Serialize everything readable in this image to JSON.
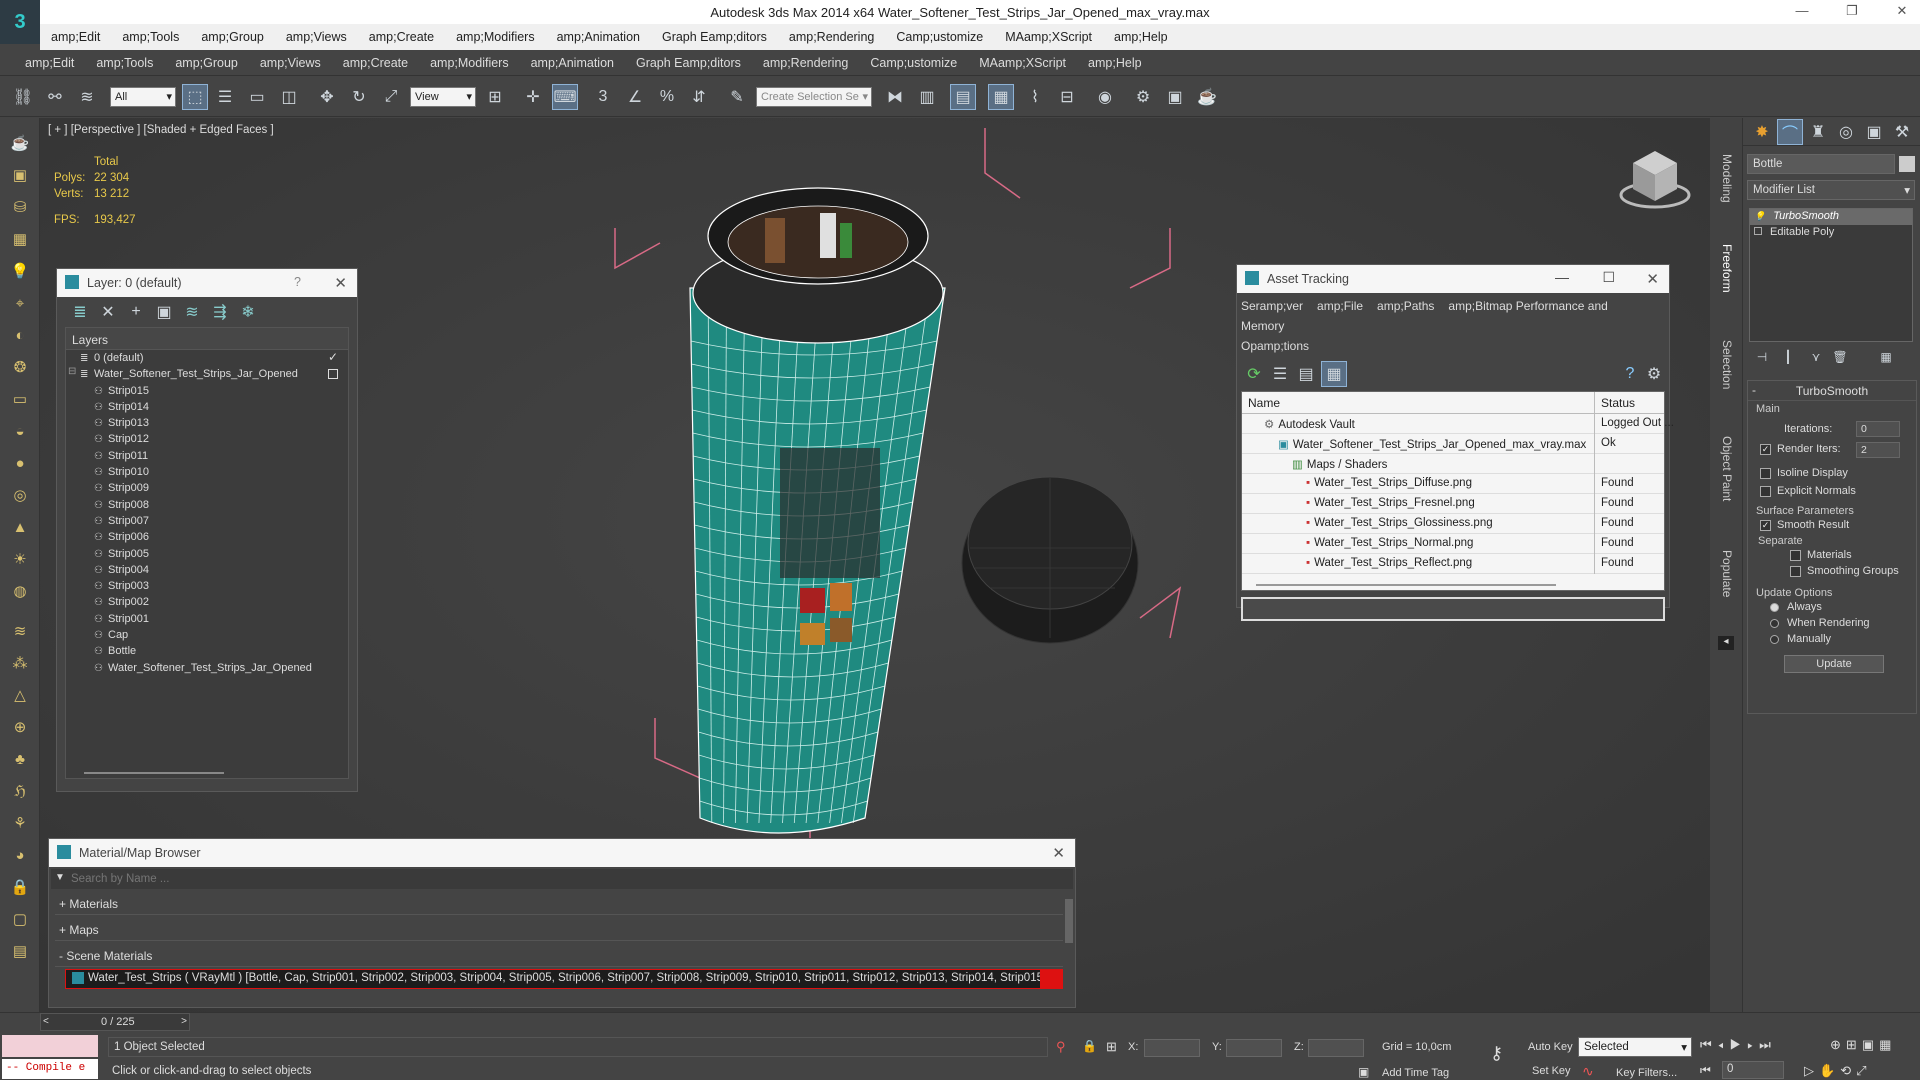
{
  "window": {
    "title": "Autodesk 3ds Max  2014 x64    Water_Softener_Test_Strips_Jar_Opened_max_vray.max"
  },
  "menu1": [
    "amp;Edit",
    "amp;Tools",
    "amp;Group",
    "amp;Views",
    "amp;Create",
    "amp;Modifiers",
    "amp;Animation",
    "Graph Eamp;ditors",
    "amp;Rendering",
    "Camp;ustomize",
    "MAamp;XScript",
    "amp;Help"
  ],
  "menu2": [
    "amp;Edit",
    "amp;Tools",
    "amp;Group",
    "amp;Views",
    "amp;Create",
    "amp;Modifiers",
    "amp;Animation",
    "Graph Eamp;ditors",
    "amp;Rendering",
    "Camp;ustomize",
    "MAamp;XScript",
    "amp;Help"
  ],
  "toolbar": {
    "filter_value": "All",
    "refcoord_value": "View",
    "selection_set_placeholder": "Create Selection Se"
  },
  "viewport": {
    "label": "[ + ] [Perspective ] [Shaded + Edged Faces ]",
    "stats_total": "Total",
    "polys_label": "Polys:",
    "polys_value": "22 304",
    "verts_label": "Verts:",
    "verts_value": "13 212",
    "fps_label": "FPS:",
    "fps_value": "193,427"
  },
  "layer_panel": {
    "title": "Layer: 0 (default)",
    "help": "?",
    "header": "Layers",
    "items": [
      {
        "label": "0 (default)",
        "indent": 1
      },
      {
        "label": "Water_Softener_Test_Strips_Jar_Opened",
        "indent": 1
      },
      {
        "label": "Strip015",
        "indent": 2
      },
      {
        "label": "Strip014",
        "indent": 2
      },
      {
        "label": "Strip013",
        "indent": 2
      },
      {
        "label": "Strip012",
        "indent": 2
      },
      {
        "label": "Strip011",
        "indent": 2
      },
      {
        "label": "Strip010",
        "indent": 2
      },
      {
        "label": "Strip009",
        "indent": 2
      },
      {
        "label": "Strip008",
        "indent": 2
      },
      {
        "label": "Strip007",
        "indent": 2
      },
      {
        "label": "Strip006",
        "indent": 2
      },
      {
        "label": "Strip005",
        "indent": 2
      },
      {
        "label": "Strip004",
        "indent": 2
      },
      {
        "label": "Strip003",
        "indent": 2
      },
      {
        "label": "Strip002",
        "indent": 2
      },
      {
        "label": "Strip001",
        "indent": 2
      },
      {
        "label": "Cap",
        "indent": 2
      },
      {
        "label": "Bottle",
        "indent": 2
      },
      {
        "label": "Water_Softener_Test_Strips_Jar_Opened",
        "indent": 2
      }
    ]
  },
  "asset_panel": {
    "title": "Asset Tracking",
    "menu": [
      "Seramp;ver",
      "amp;File",
      "amp;Paths",
      "amp;Bitmap Performance and Memory"
    ],
    "menu2": "Opamp;tions",
    "col_name": "Name",
    "col_status": "Status",
    "rows": [
      {
        "name": "Autodesk Vault",
        "status": "Logged Out ...",
        "indent": 1
      },
      {
        "name": "Water_Softener_Test_Strips_Jar_Opened_max_vray.max",
        "status": "Ok",
        "indent": 2
      },
      {
        "name": "Maps / Shaders",
        "status": "",
        "indent": 3
      },
      {
        "name": "Water_Test_Strips_Diffuse.png",
        "status": "Found",
        "indent": 4
      },
      {
        "name": "Water_Test_Strips_Fresnel.png",
        "status": "Found",
        "indent": 4
      },
      {
        "name": "Water_Test_Strips_Glossiness.png",
        "status": "Found",
        "indent": 4
      },
      {
        "name": "Water_Test_Strips_Normal.png",
        "status": "Found",
        "indent": 4
      },
      {
        "name": "Water_Test_Strips_Reflect.png",
        "status": "Found",
        "indent": 4
      }
    ]
  },
  "material_browser": {
    "title": "Material/Map Browser",
    "search_placeholder": "Search by Name ...",
    "sections": [
      "+ Materials",
      "+ Maps",
      "- Scene Materials"
    ],
    "scene_material": "Water_Test_Strips  ( VRayMtl ) [Bottle, Cap, Strip001, Strip002, Strip003, Strip004, Strip005, Strip006, Strip007, Strip008, Strip009, Strip010, Strip011, Strip012, Strip013, Strip014, Strip015]"
  },
  "side_tabs": [
    "Modeling",
    "Freeform",
    "Selection",
    "Object Paint",
    "Populate"
  ],
  "command_panel": {
    "object_name": "Bottle",
    "modifier_list": "Modifier List",
    "stack": [
      "TurboSmooth",
      "Editable Poly"
    ],
    "rollout_title": "TurboSmooth",
    "main_label": "Main",
    "iterations_label": "Iterations:",
    "iterations_value": "0",
    "render_iters_label": "Render Iters:",
    "render_iters_value": "2",
    "isoline": "Isoline Display",
    "explicit_normals": "Explicit Normals",
    "surface_params": "Surface Parameters",
    "smooth_result": "Smooth Result",
    "separate": "Separate",
    "materials": "Materials",
    "smoothing_groups": "Smoothing Groups",
    "update_options": "Update Options",
    "always": "Always",
    "when_rendering": "When Rendering",
    "manually": "Manually",
    "update_button": "Update"
  },
  "status": {
    "compile": "-- Compile e",
    "selected": "1 Object Selected",
    "prompt": "Click or click-and-drag to select objects",
    "frame": "0 / 225",
    "x_label": "X:",
    "y_label": "Y:",
    "z_label": "Z:",
    "grid": "Grid = 10,0cm",
    "add_time_tag": "Add Time Tag",
    "auto_key": "Auto Key",
    "set_key": "Set Key",
    "selected_value": "Selected",
    "key_filters": "Key Filters...",
    "frame_value": "0"
  },
  "colors": {
    "accent": "#2a8c9e",
    "highlight_red": "#d11",
    "stats_yellow": "#e8c94a"
  }
}
